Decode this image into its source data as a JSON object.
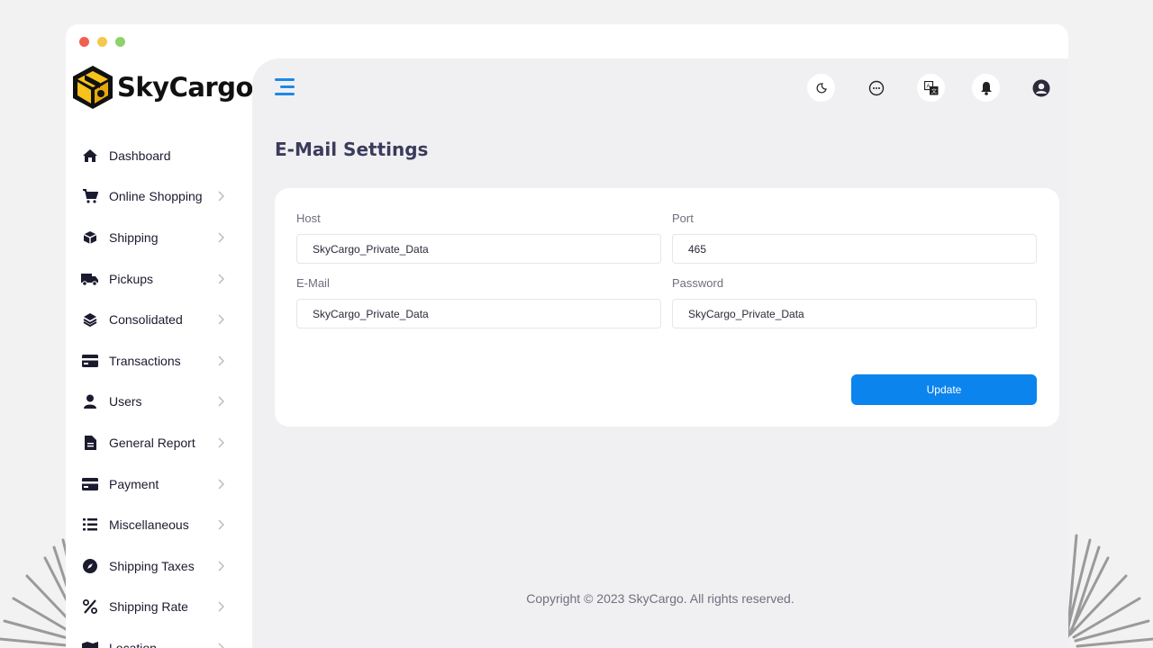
{
  "app": {
    "brand": "SkyCargo",
    "accent_color": "#0b84ed"
  },
  "sidebar": {
    "items": [
      {
        "label": "Dashboard",
        "icon": "home-icon",
        "has_submenu": false
      },
      {
        "label": "Online Shopping",
        "icon": "shopping-cart-icon",
        "has_submenu": true
      },
      {
        "label": "Shipping",
        "icon": "box-icon",
        "has_submenu": true
      },
      {
        "label": "Pickups",
        "icon": "truck-icon",
        "has_submenu": true
      },
      {
        "label": "Consolidated",
        "icon": "layers-icon",
        "has_submenu": true
      },
      {
        "label": "Transactions",
        "icon": "credit-card-icon",
        "has_submenu": true
      },
      {
        "label": "Users",
        "icon": "user-icon",
        "has_submenu": true
      },
      {
        "label": "General Report",
        "icon": "file-icon",
        "has_submenu": true
      },
      {
        "label": "Payment",
        "icon": "credit-card-icon",
        "has_submenu": true
      },
      {
        "label": "Miscellaneous",
        "icon": "list-icon",
        "has_submenu": true
      },
      {
        "label": "Shipping Taxes",
        "icon": "compass-icon",
        "has_submenu": true
      },
      {
        "label": "Shipping Rate",
        "icon": "percent-icon",
        "has_submenu": true
      },
      {
        "label": "Location",
        "icon": "map-icon",
        "has_submenu": true
      }
    ]
  },
  "topbar": {
    "icons": [
      "moon-icon",
      "chat-icon",
      "translate-icon",
      "bell-icon",
      "user-circle-icon"
    ]
  },
  "page": {
    "title": "E-Mail Settings"
  },
  "form": {
    "host": {
      "label": "Host",
      "value": "SkyCargo_Private_Data"
    },
    "port": {
      "label": "Port",
      "value": "465"
    },
    "email": {
      "label": "E-Mail",
      "value": "SkyCargo_Private_Data"
    },
    "password": {
      "label": "Password",
      "value": "SkyCargo_Private_Data"
    },
    "update_label": "Update"
  },
  "footer": {
    "copyright": "Copyright © 2023 SkyCargo. All rights reserved."
  }
}
